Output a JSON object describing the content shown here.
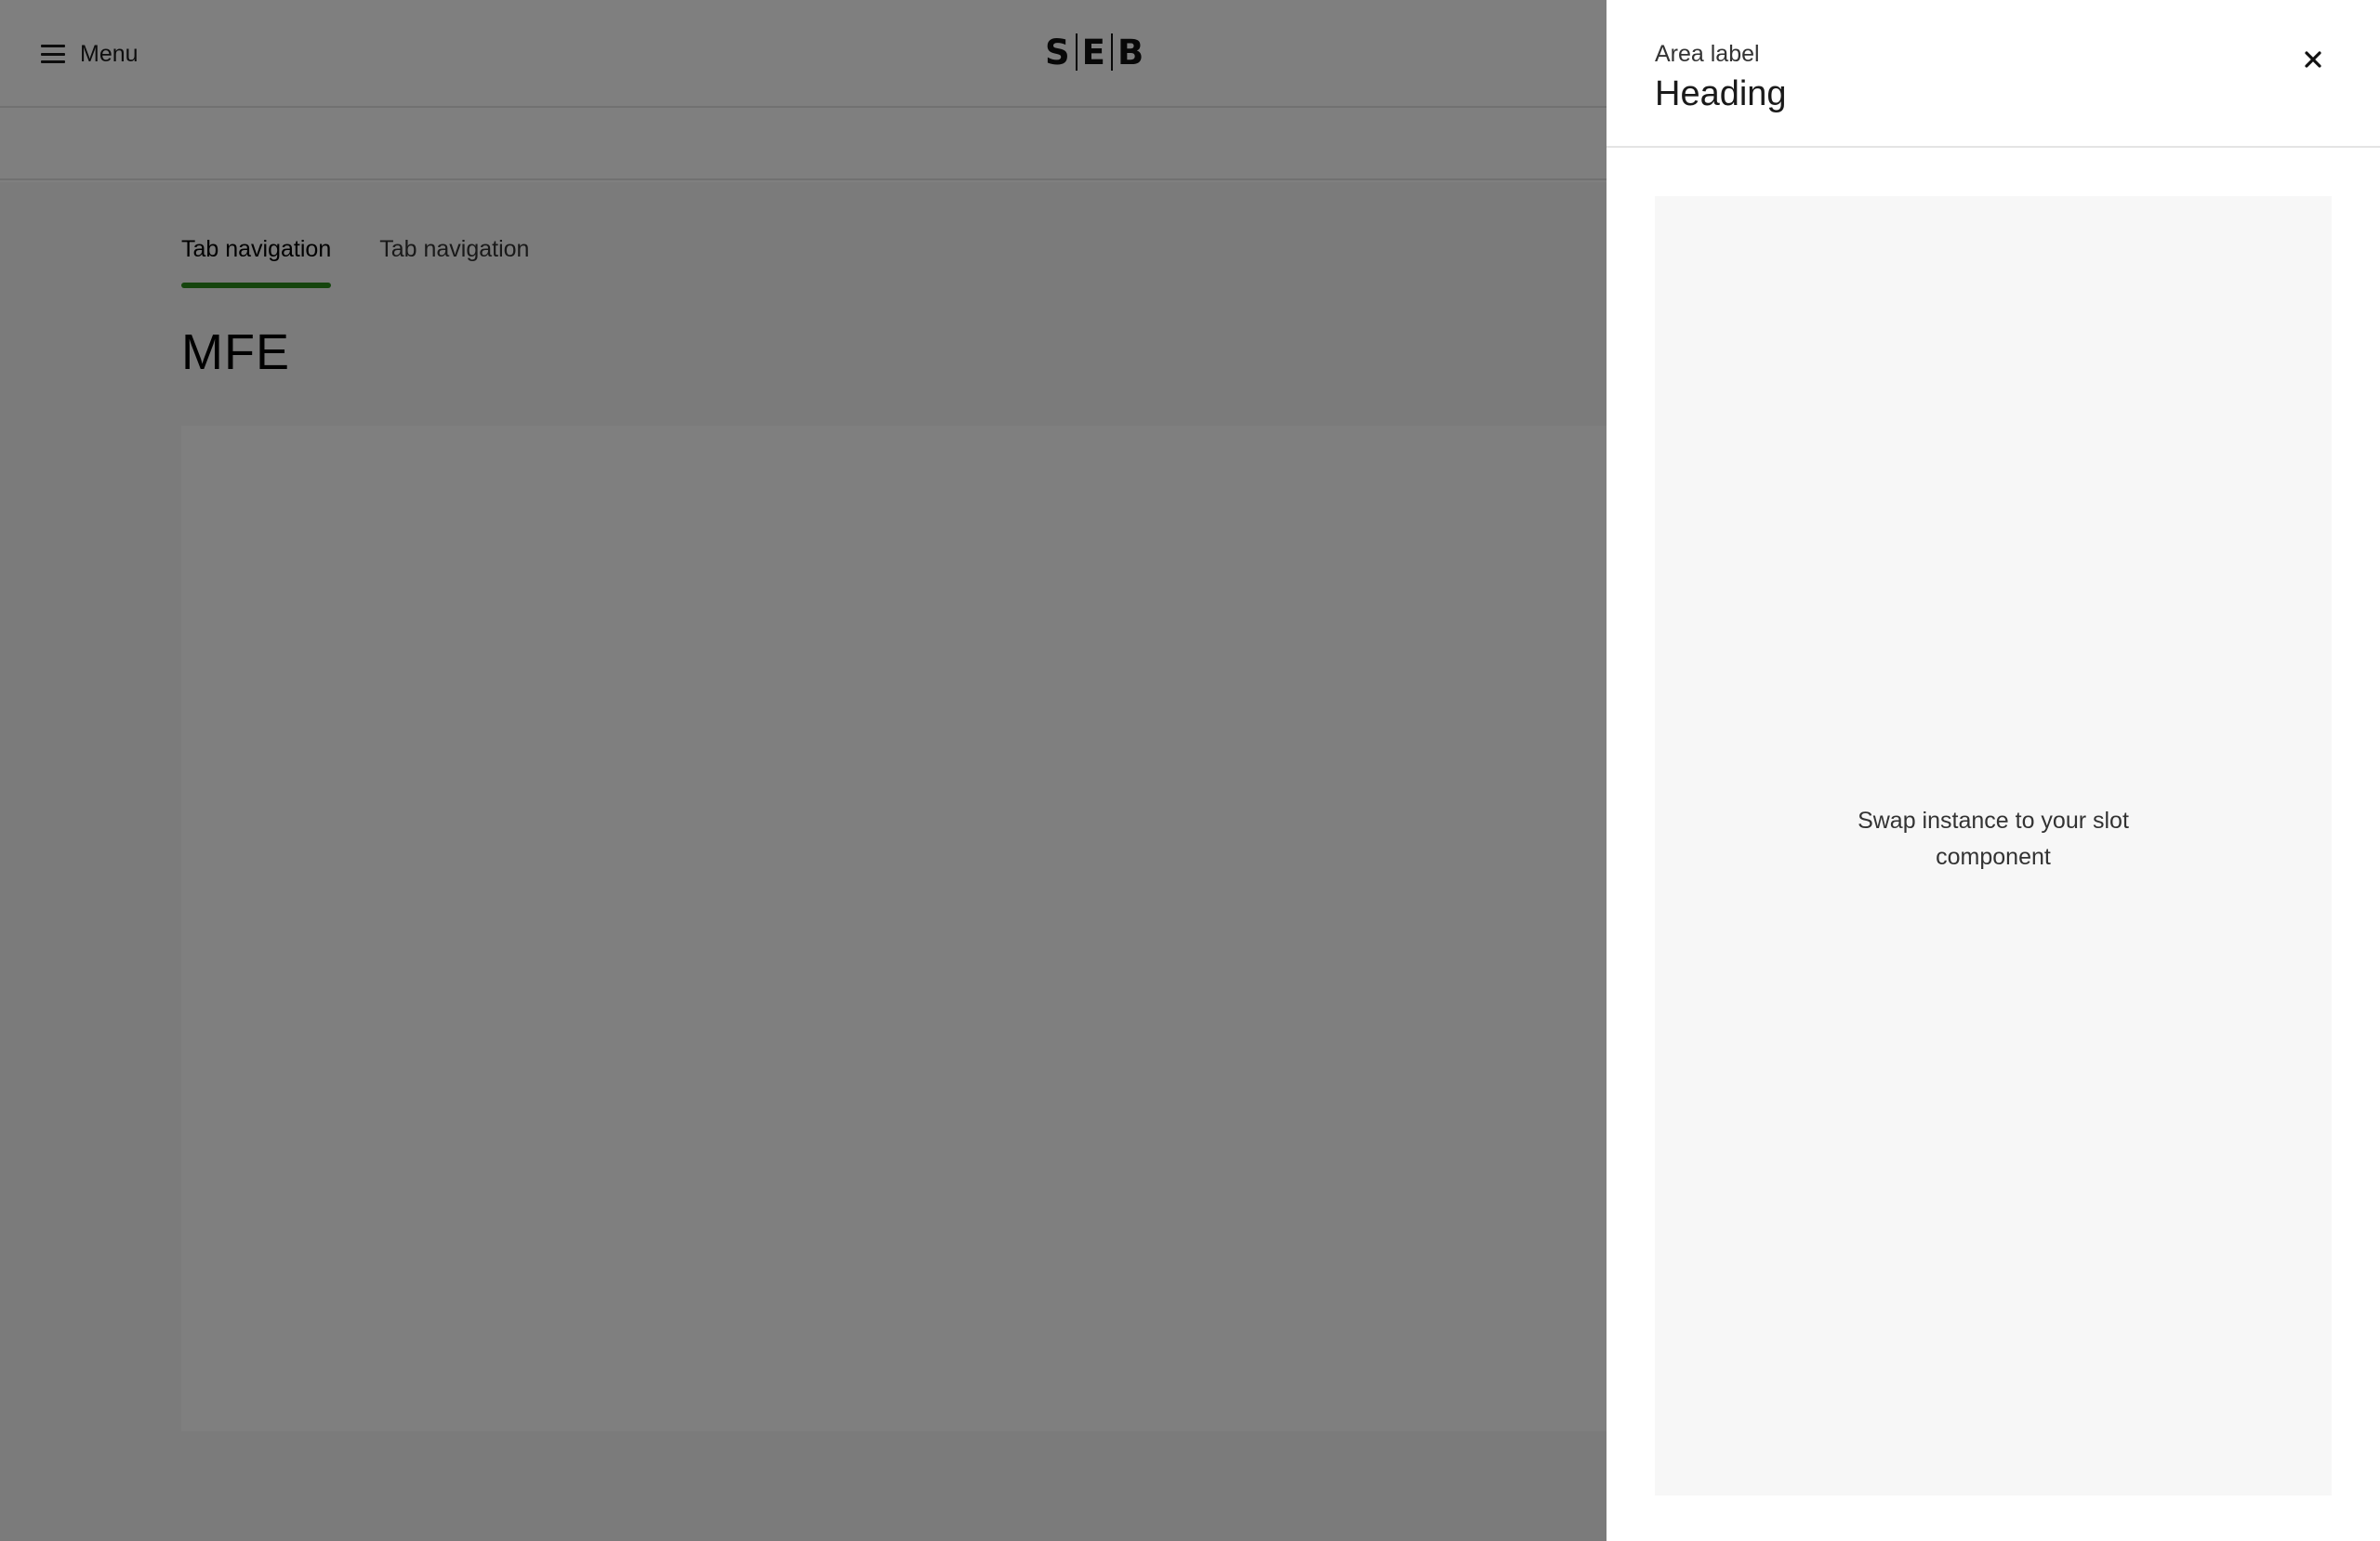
{
  "header": {
    "menu_label": "Menu",
    "logo": {
      "left": "S",
      "middle": "E",
      "right": "B"
    }
  },
  "tabs": [
    {
      "label": "Tab navigation",
      "active": true
    },
    {
      "label": "Tab navigation",
      "active": false
    }
  ],
  "main": {
    "title": "MFE"
  },
  "drawer": {
    "area_label": "Area label",
    "heading": "Heading",
    "slot_text": "Swap instance to your slot component",
    "icons": {
      "close": "close-icon"
    }
  },
  "colors": {
    "tab_indicator": "#2a8a1a",
    "overlay": "rgba(0,0,0,0.5)",
    "slot_background": "#f7f7f7"
  }
}
